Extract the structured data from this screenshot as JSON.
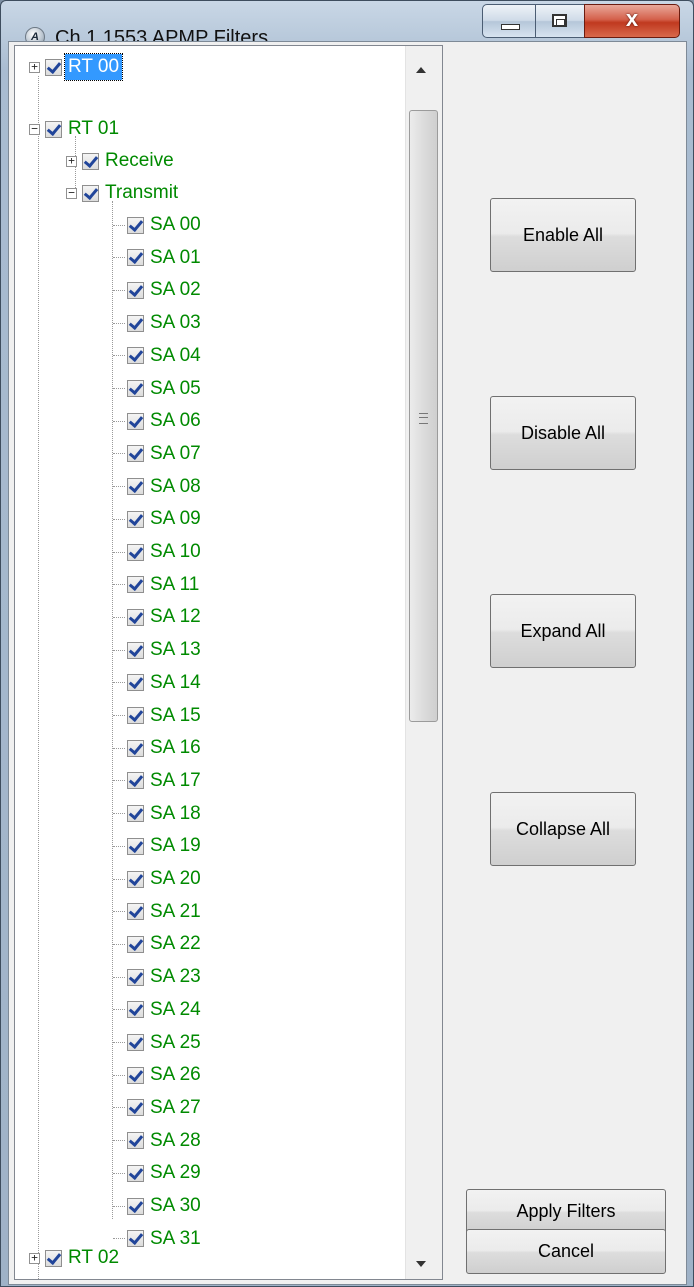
{
  "window": {
    "title": "Ch 1 1553 APMP Filters",
    "icon_text": "A",
    "controls": {
      "minimize_icon": "minimize-icon",
      "maximize_icon": "maximize-icon",
      "close_icon": "close-icon",
      "close_glyph": "x"
    }
  },
  "tree": {
    "rt00": {
      "label": "RT 00",
      "expander": "+",
      "checked": true,
      "selected": true
    },
    "rt01": {
      "label": "RT 01",
      "expander": "−",
      "checked": true
    },
    "receive": {
      "label": "Receive",
      "expander": "+",
      "checked": true
    },
    "transmit": {
      "label": "Transmit",
      "expander": "−",
      "checked": true
    },
    "subaddresses": [
      "SA 00",
      "SA 01",
      "SA 02",
      "SA 03",
      "SA 04",
      "SA 05",
      "SA 06",
      "SA 07",
      "SA 08",
      "SA 09",
      "SA 10",
      "SA 11",
      "SA 12",
      "SA 13",
      "SA 14",
      "SA 15",
      "SA 16",
      "SA 17",
      "SA 18",
      "SA 19",
      "SA 20",
      "SA 21",
      "SA 22",
      "SA 23",
      "SA 24",
      "SA 25",
      "SA 26",
      "SA 27",
      "SA 28",
      "SA 29",
      "SA 30",
      "SA 31"
    ],
    "rt02": {
      "label": "RT 02",
      "expander": "+",
      "checked": true
    }
  },
  "buttons": {
    "enable_all": "Enable All",
    "disable_all": "Disable All",
    "expand_all": "Expand All",
    "collapse_all": "Collapse All",
    "apply_filters": "Apply Filters",
    "cancel": "Cancel"
  },
  "colors": {
    "node_text": "#008a00",
    "selection": "#3399ff",
    "check": "#21459a"
  }
}
